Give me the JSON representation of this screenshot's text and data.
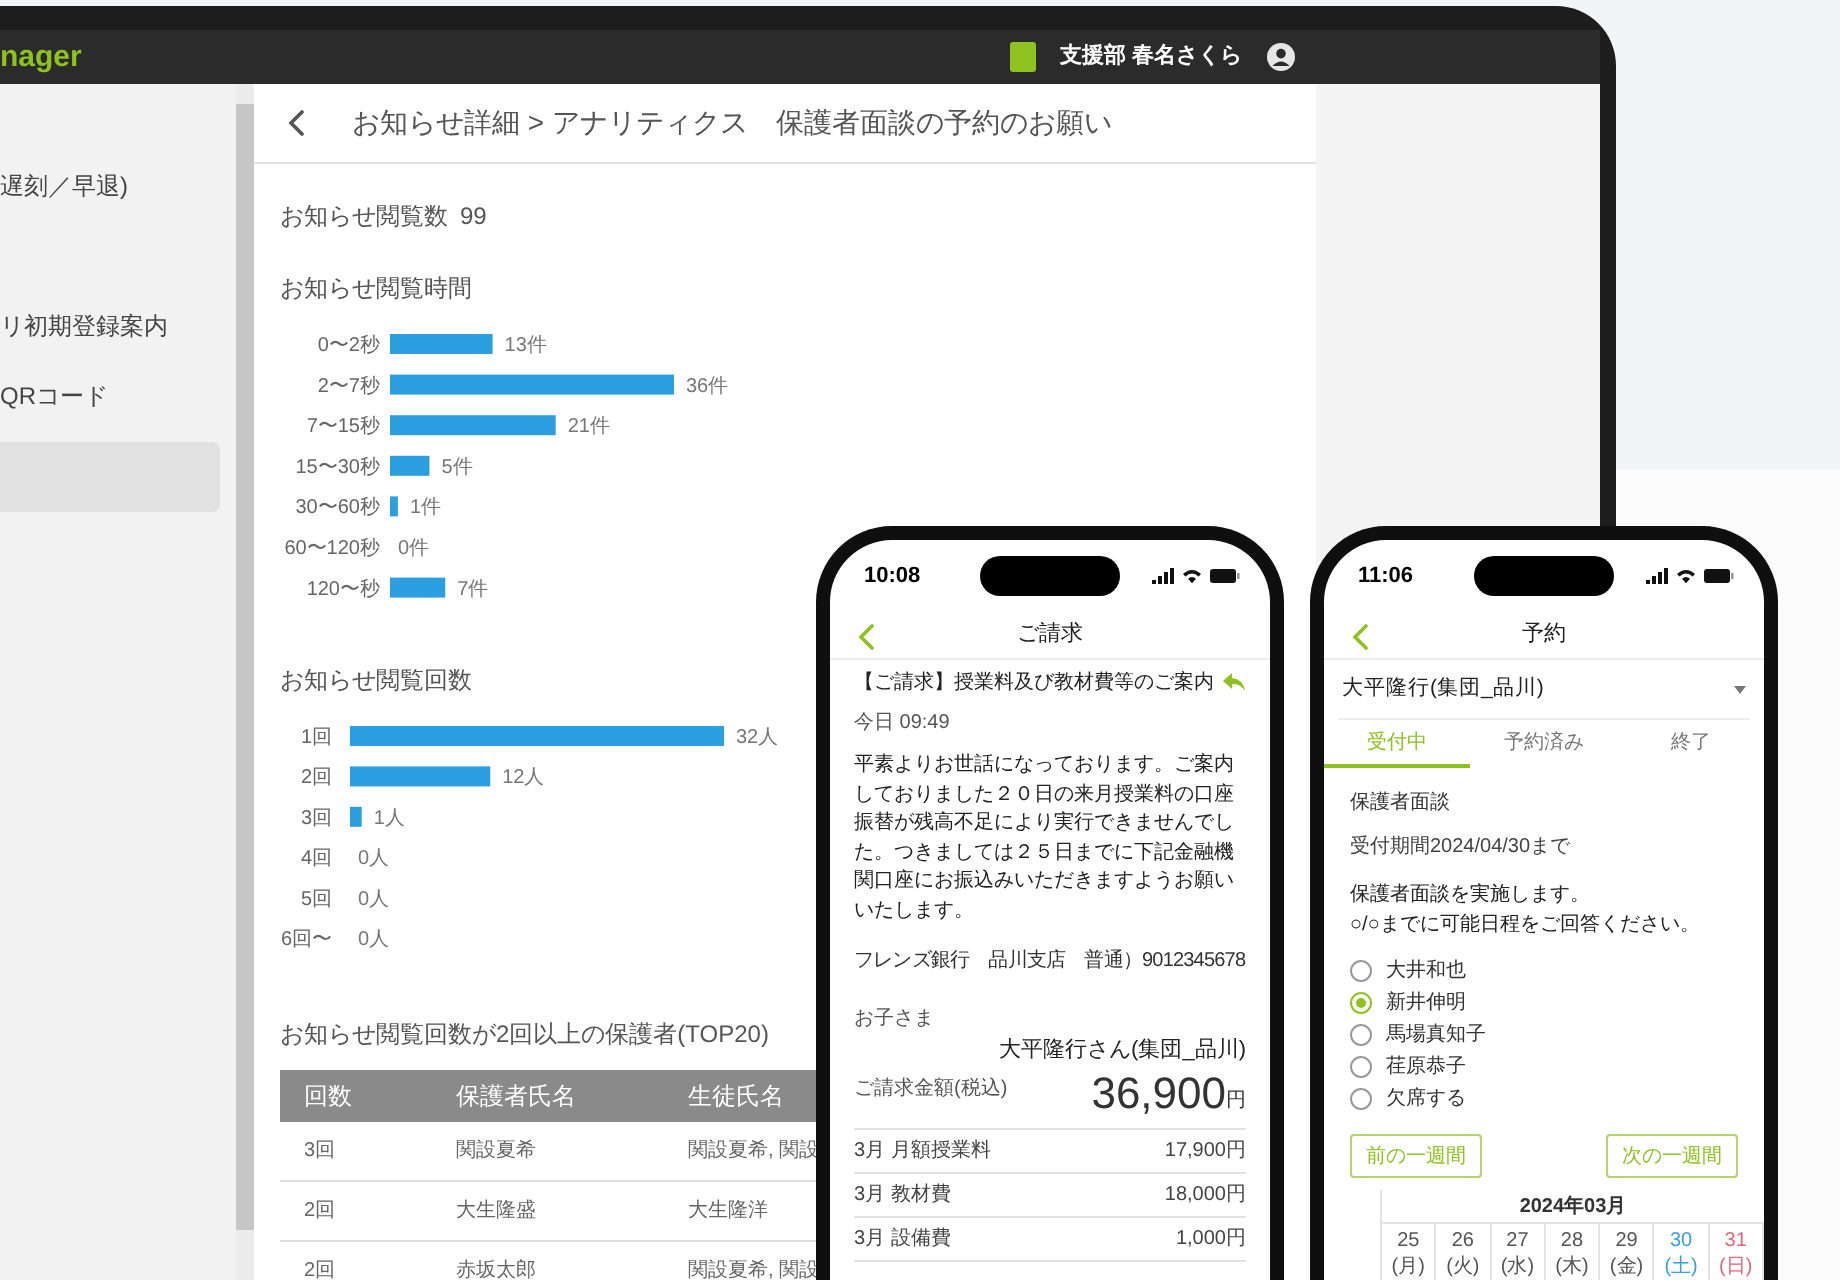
{
  "laptop": {
    "header": {
      "app_name": "nager",
      "user": "支援部 春名さくら"
    },
    "sidebar": {
      "items": [
        {
          "label": "遅刻／早退)",
          "selected": false
        },
        {
          "label": "リ初期登録案内",
          "selected": false
        },
        {
          "label": "QRコード",
          "selected": false
        },
        {
          "selected": true
        }
      ]
    },
    "page_title": "お知らせ詳細 > アナリティクス　保護者面談の予約のお願い",
    "views": {
      "label": "お知らせ閲覧数",
      "value": "99"
    },
    "view_time": {
      "chart_data": {
        "type": "bar",
        "orientation": "horizontal",
        "title": "お知らせ閲覧時間",
        "categories": [
          "0〜2秒",
          "2〜7秒",
          "7〜15秒",
          "15〜30秒",
          "30〜60秒",
          "60〜120秒",
          "120〜秒"
        ],
        "values": [
          13,
          36,
          21,
          5,
          1,
          0,
          7
        ],
        "value_labels": [
          "13件",
          "36件",
          "21件",
          "5件",
          "1件",
          "0件",
          "7件"
        ]
      }
    },
    "view_count": {
      "chart_data": {
        "type": "bar",
        "orientation": "horizontal",
        "title": "お知らせ閲覧回数",
        "categories": [
          "1回",
          "2回",
          "3回",
          "4回",
          "5回",
          "6回〜"
        ],
        "values": [
          32,
          12,
          1,
          0,
          0,
          0
        ],
        "value_labels": [
          "32人",
          "12人",
          "1人",
          "0人",
          "0人",
          "0人"
        ]
      }
    },
    "table": {
      "title": "お知らせ閲覧回数が2回以上の保護者(TOP20)",
      "columns": [
        "回数",
        "保護者氏名",
        "生徒氏名"
      ],
      "rows": [
        [
          "3回",
          "関設夏希",
          "関設夏希, 関設"
        ],
        [
          "2回",
          "大生隆盛",
          "大生隆洋"
        ],
        [
          "2回",
          "赤坂太郎",
          "関設夏希, 関設"
        ]
      ]
    }
  },
  "phone_invoice": {
    "time": "10:08",
    "title": "ご請求",
    "subject": "【ご請求】授業料及び教材費等のご案内",
    "date": "今日 09:49",
    "body": "平素よりお世話になっております。ご案内しておりました２０日の来月授業料の口座振替が残高不足により実行できませんでした。つきましては２５日までに下記金融機関口座にお振込みいただきますようお願いいたします。",
    "bank": "フレンズ銀行　品川支店　普通）9012345678",
    "child_label": "お子さま",
    "child_name": "大平隆行さん(集団_品川)",
    "amount_label": "ご請求金額(税込)",
    "amount": "36,900",
    "currency": "円",
    "items": [
      {
        "name": "3月 月額授業料",
        "price": "17,900円"
      },
      {
        "name": "3月 教材費",
        "price": "18,000円"
      },
      {
        "name": "3月 設備費",
        "price": "1,000円"
      }
    ]
  },
  "phone_booking": {
    "time": "11:06",
    "title": "予約",
    "student": "大平隆行(集団_品川)",
    "tabs": [
      {
        "label": "受付中",
        "selected": true
      },
      {
        "label": "予約済み",
        "selected": false
      },
      {
        "label": "終了",
        "selected": false
      }
    ],
    "event": "保護者面談",
    "period": "受付期間2024/04/30まで",
    "message": "保護者面談を実施します。\n○/○までに可能日程をご回答ください。",
    "options": [
      {
        "label": "大井和也",
        "selected": false
      },
      {
        "label": "新井伸明",
        "selected": true
      },
      {
        "label": "馬場真知子",
        "selected": false
      },
      {
        "label": "荏原恭子",
        "selected": false
      },
      {
        "label": "欠席する",
        "selected": false
      }
    ],
    "prev_button": "前の一週間",
    "next_button": "次の一週間",
    "calendar": {
      "month": "2024年03月",
      "days": [
        {
          "date": "25",
          "weekday": "(月)",
          "color": "#555555"
        },
        {
          "date": "26",
          "weekday": "(火)",
          "color": "#555555"
        },
        {
          "date": "27",
          "weekday": "(水)",
          "color": "#555555"
        },
        {
          "date": "28",
          "weekday": "(木)",
          "color": "#555555"
        },
        {
          "date": "29",
          "weekday": "(金)",
          "color": "#555555"
        },
        {
          "date": "30",
          "weekday": "(土)",
          "color": "#3aa0d8"
        },
        {
          "date": "31",
          "weekday": "(日)",
          "color": "#e06878"
        }
      ]
    }
  }
}
